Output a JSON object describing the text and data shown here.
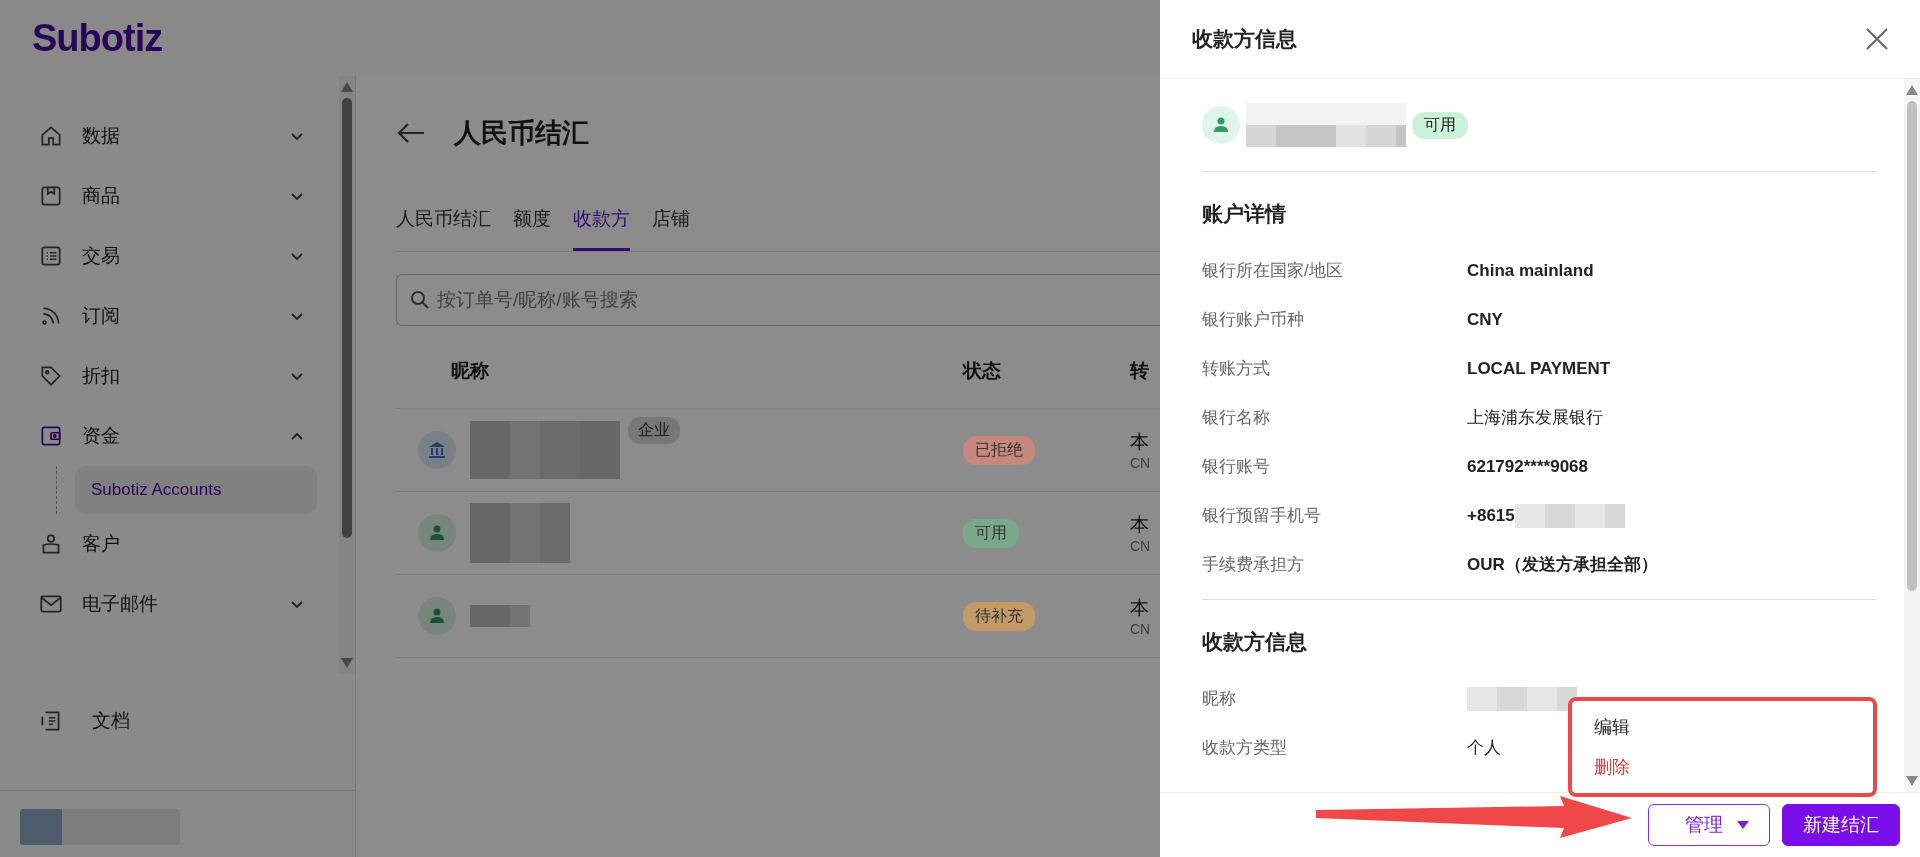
{
  "logo": "Subotiz",
  "sidebar": {
    "items": [
      {
        "label": "数据",
        "kind": "group",
        "expanded": false
      },
      {
        "label": "商品",
        "kind": "group",
        "expanded": false
      },
      {
        "label": "交易",
        "kind": "group",
        "expanded": false
      },
      {
        "label": "订阅",
        "kind": "group",
        "expanded": false
      },
      {
        "label": "折扣",
        "kind": "group",
        "expanded": false
      },
      {
        "label": "资金",
        "kind": "group",
        "expanded": true,
        "selected": true,
        "children": [
          {
            "label": "Subotiz Accounts",
            "selected": true
          }
        ]
      },
      {
        "label": "客户",
        "kind": "link",
        "selected": false
      },
      {
        "label": "电子邮件",
        "kind": "group",
        "expanded": false
      }
    ],
    "footer_link": "文档"
  },
  "page": {
    "title": "人民币结汇",
    "tabs": [
      {
        "label": "人民币结汇",
        "selected": false
      },
      {
        "label": "额度",
        "selected": false
      },
      {
        "label": "收款方",
        "selected": true
      },
      {
        "label": "店铺",
        "selected": false
      }
    ],
    "search": {
      "placeholder": "按订单号/昵称/账号搜索"
    },
    "table": {
      "columns": [
        "昵称",
        "状态",
        "转"
      ],
      "rows": [
        {
          "kind": "company",
          "tag": "企业",
          "status": "已拒绝",
          "color": "#c7877c",
          "column_3": "本",
          "column_3_sub": "CN"
        },
        {
          "kind": "person",
          "status": "可用",
          "color": "#7aa98a",
          "column_3": "本",
          "column_3_sub": "CN"
        },
        {
          "kind": "person",
          "status": "待补充",
          "color": "#c49968",
          "column_3": "本",
          "column_3_sub": "CN"
        }
      ]
    }
  },
  "drawer": {
    "title": "收款方信息",
    "summary": {
      "status": "可用",
      "color": "#c9f2d8"
    },
    "sections": [
      {
        "title": "账户详情",
        "rows": [
          {
            "label": "银行所在国家/地区",
            "value": "China mainland",
            "redacted": false
          },
          {
            "label": "银行账户币种",
            "value": "CNY",
            "redacted": false
          },
          {
            "label": "转账方式",
            "value": "LOCAL PAYMENT",
            "redacted": false
          },
          {
            "label": "银行名称",
            "value": "上海浦东发展银行",
            "redacted": false
          },
          {
            "label": "银行账号",
            "value": "621792****9068",
            "redacted": false
          },
          {
            "label": "银行预留手机号",
            "value": "+8615",
            "redacted": true
          },
          {
            "label": "手续费承担方",
            "value": "OUR（发送方承担全部）",
            "redacted": false
          }
        ]
      },
      {
        "title": "收款方信息",
        "rows": [
          {
            "label": "昵称",
            "redacted": true
          },
          {
            "label": "收款方类型",
            "value": "个人",
            "redacted": false
          }
        ]
      }
    ],
    "menu": [
      {
        "label": "编辑",
        "kind": "normal"
      },
      {
        "label": "删除",
        "kind": "danger"
      }
    ],
    "buttons": [
      {
        "label": "管理",
        "kind": "outline"
      },
      {
        "label": "新建结汇",
        "kind": "primary"
      }
    ]
  }
}
